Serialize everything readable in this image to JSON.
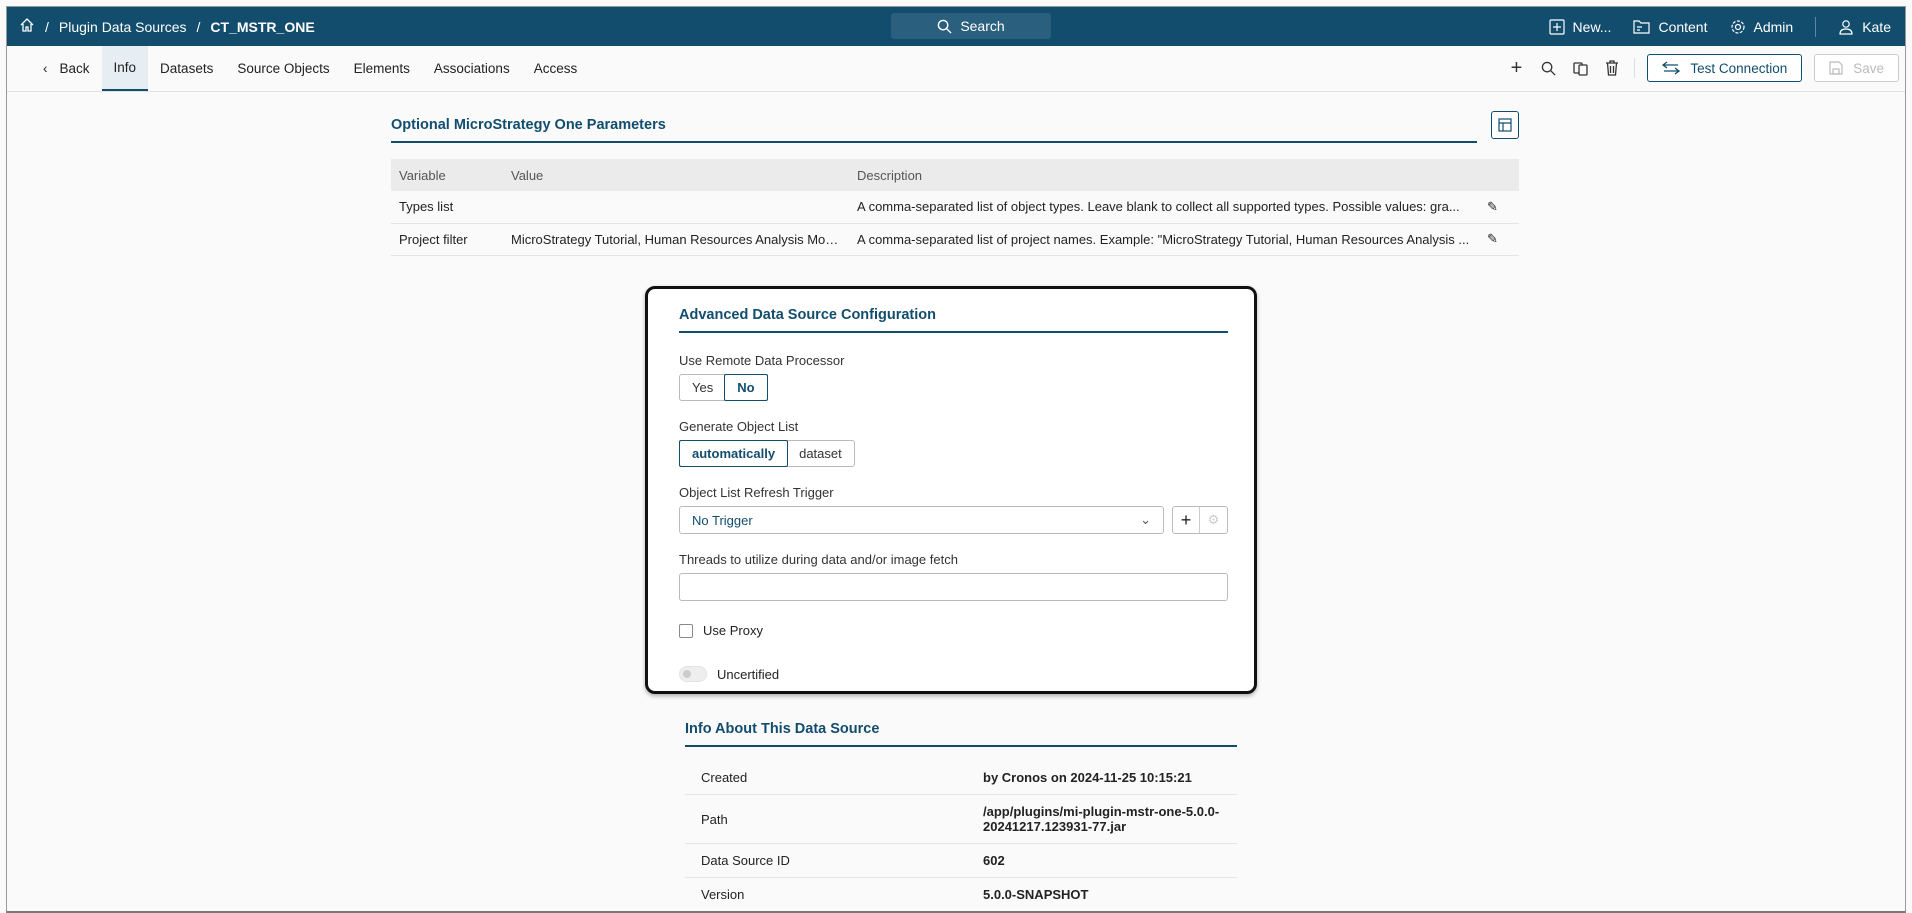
{
  "topbar": {
    "breadcrumb": [
      "Plugin Data Sources",
      "CT_MSTR_ONE"
    ],
    "search": "Search",
    "new": "New...",
    "content": "Content",
    "admin": "Admin",
    "user": "Kate"
  },
  "tabs": {
    "back": "Back",
    "items": [
      "Info",
      "Datasets",
      "Source Objects",
      "Elements",
      "Associations",
      "Access"
    ],
    "active": "Info"
  },
  "toolbar": {
    "test_connection": "Test Connection",
    "save": "Save"
  },
  "params": {
    "title": "Optional MicroStrategy One Parameters",
    "headers": [
      "Variable",
      "Value",
      "Description"
    ],
    "rows": [
      {
        "variable": "Types list",
        "value": "",
        "description": "A comma-separated list of object types. Leave blank to collect all supported types. Possible values: gra..."
      },
      {
        "variable": "Project filter",
        "value": "MicroStrategy Tutorial, Human Resources Analysis Mod...",
        "description": "A comma-separated list of project names. Example: \"MicroStrategy Tutorial, Human Resources Analysis ..."
      }
    ]
  },
  "advanced": {
    "title": "Advanced Data Source Configuration",
    "remote_label": "Use Remote Data Processor",
    "remote_options": [
      "Yes",
      "No"
    ],
    "remote_selected": "No",
    "gen_label": "Generate Object List",
    "gen_options": [
      "automatically",
      "dataset"
    ],
    "gen_selected": "automatically",
    "trigger_label": "Object List Refresh Trigger",
    "trigger_value": "No Trigger",
    "threads_label": "Threads to utilize during data and/or image fetch",
    "threads_value": "",
    "proxy_label": "Use Proxy",
    "certified_label": "Uncertified"
  },
  "info": {
    "title": "Info About This Data Source",
    "rows": [
      {
        "label": "Created",
        "value": "by Cronos on 2024-11-25 10:15:21"
      },
      {
        "label": "Path",
        "value": "/app/plugins/mi-plugin-mstr-one-5.0.0-20241217.123931-77.jar"
      },
      {
        "label": "Data Source ID",
        "value": "602"
      },
      {
        "label": "Version",
        "value": "5.0.0-SNAPSHOT"
      }
    ]
  }
}
